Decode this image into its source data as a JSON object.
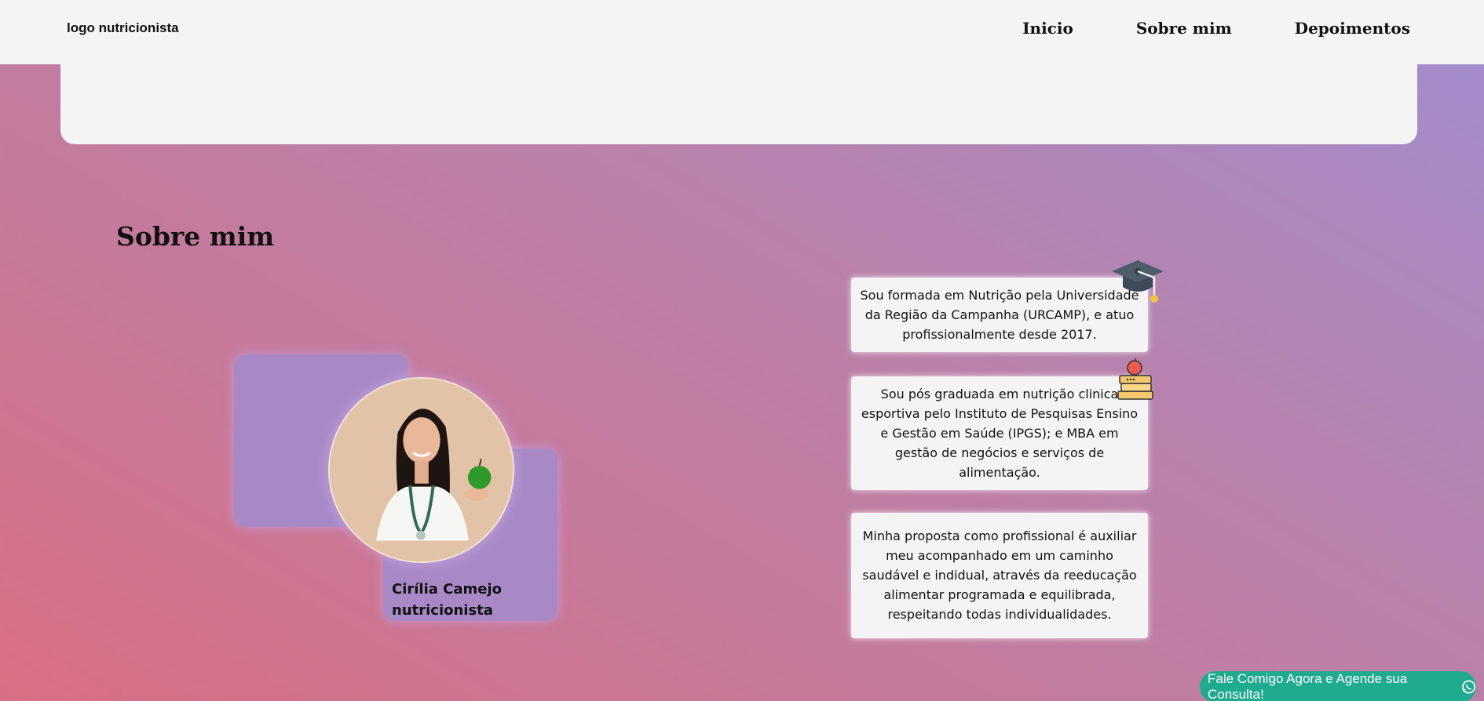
{
  "header": {
    "logo_text": "logo nutricionista",
    "nav": [
      {
        "label": "Inicio"
      },
      {
        "label": "Sobre mim"
      },
      {
        "label": "Depoimentos"
      }
    ]
  },
  "about": {
    "title": "Sobre mim",
    "profile": {
      "name": "Cirília Camejo",
      "role": "nutricionista",
      "avatar_icon": "nutritionist-photo"
    },
    "cards": [
      {
        "icon": "graduation-cap-icon",
        "text": "Sou formada em Nutrição pela Universidade da Região da Campanha (URCAMP), e atuo profissionalmente desde 2017."
      },
      {
        "icon": "books-apple-icon",
        "text": "Sou pós graduada em nutrição clinica esportiva pelo Instituto de Pesquisas Ensino e Gestão em Saúde (IPGS); e MBA em gestão de negócios e serviços de alimentação."
      },
      {
        "icon": "",
        "text": "Minha proposta como profissional é auxiliar meu acompanhado em um caminho saudável e indidual, através da reeducação alimentar programada e equilibrada, respeitando todas individualidades."
      }
    ]
  },
  "whatsapp_cta": {
    "label": "Fale Comigo Agora e Agende sua Consulta!",
    "icon": "whatsapp-icon",
    "color": "#1fab8d"
  },
  "colors": {
    "header_bg": "#f4f4f4",
    "deco_purple": "#a889c6",
    "gradient_start": "#d76f82",
    "gradient_end": "#a18dd0"
  }
}
